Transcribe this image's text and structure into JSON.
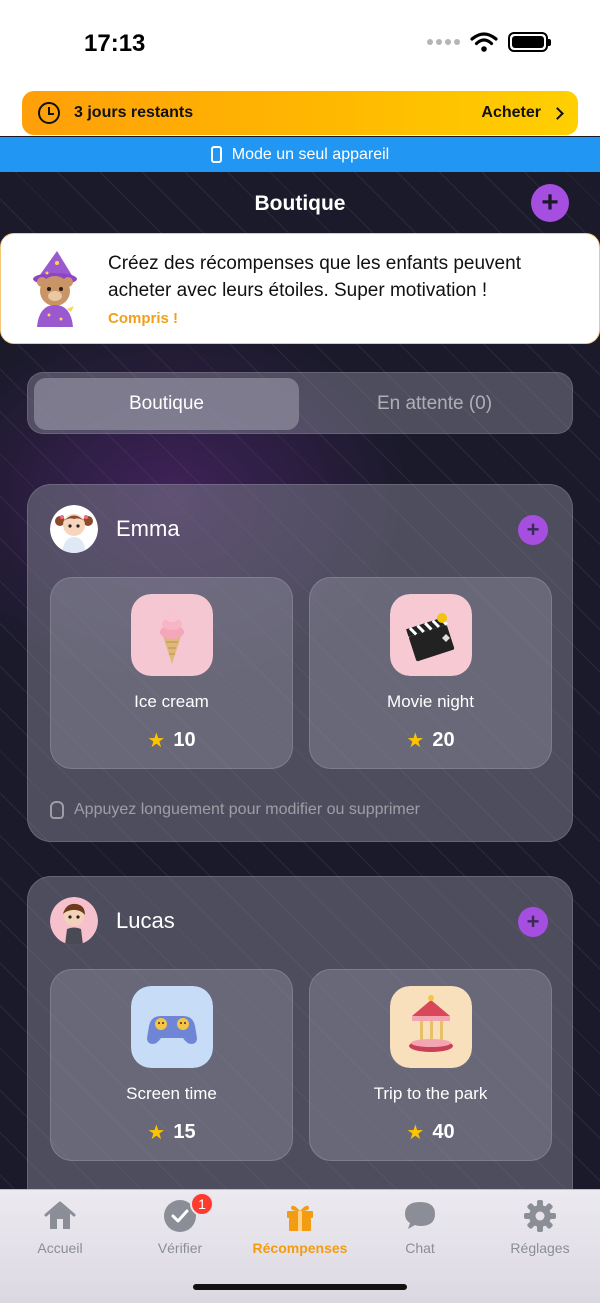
{
  "status": {
    "time": "17:13"
  },
  "trial": {
    "text": "3 jours restants",
    "cta": "Acheter"
  },
  "mode": {
    "text": "Mode un seul appareil"
  },
  "header": {
    "title": "Boutique"
  },
  "tip": {
    "text": "Créez des récompenses que les enfants peuvent acheter avec leurs étoiles. Super motivation !",
    "link": "Compris !"
  },
  "segments": {
    "shop": "Boutique",
    "pending": "En attente (0)"
  },
  "children": [
    {
      "name": "Emma",
      "rewards": [
        {
          "title": "Ice cream",
          "price": "10",
          "icon": "ice-cream-icon"
        },
        {
          "title": "Movie night",
          "price": "20",
          "icon": "clapperboard-icon"
        }
      ],
      "hint": "Appuyez longuement pour modifier ou supprimer"
    },
    {
      "name": "Lucas",
      "rewards": [
        {
          "title": "Screen time",
          "price": "15",
          "icon": "gamepad-icon"
        },
        {
          "title": "Trip to the park",
          "price": "40",
          "icon": "carousel-icon"
        }
      ]
    }
  ],
  "tabs": [
    {
      "label": "Accueil",
      "icon": "home-icon"
    },
    {
      "label": "Vérifier",
      "icon": "check-circle-icon",
      "badge": "1"
    },
    {
      "label": "Récompenses",
      "icon": "gift-icon",
      "active": true
    },
    {
      "label": "Chat",
      "icon": "chat-bubble-icon"
    },
    {
      "label": "Réglages",
      "icon": "gear-icon"
    }
  ],
  "colors": {
    "accent": "#a64ee0",
    "orange": "#f39c12",
    "blue": "#2196f3",
    "star": "#ffc400"
  }
}
